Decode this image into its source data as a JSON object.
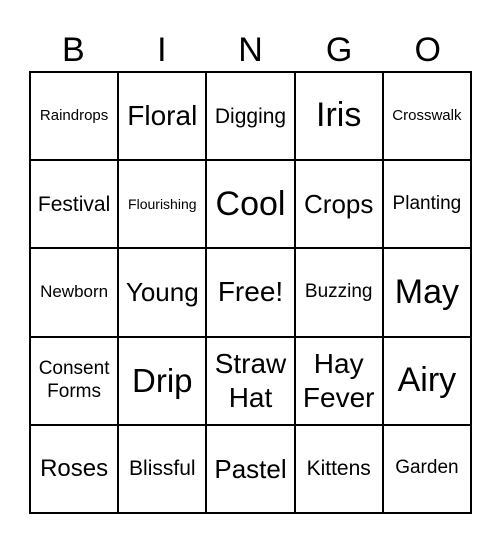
{
  "header": [
    "B",
    "I",
    "N",
    "G",
    "O"
  ],
  "cells": [
    [
      "Raindrops",
      "Floral",
      "Digging",
      "Iris",
      "Crosswalk"
    ],
    [
      "Festival",
      "Flourishing",
      "Cool",
      "Crops",
      "Planting"
    ],
    [
      "Newborn",
      "Young",
      "Free!",
      "Buzzing",
      "May"
    ],
    [
      "Consent Forms",
      "Drip",
      "Straw Hat",
      "Hay Fever",
      "Airy"
    ],
    [
      "Roses",
      "Blissful",
      "Pastel",
      "Kittens",
      "Garden"
    ]
  ]
}
